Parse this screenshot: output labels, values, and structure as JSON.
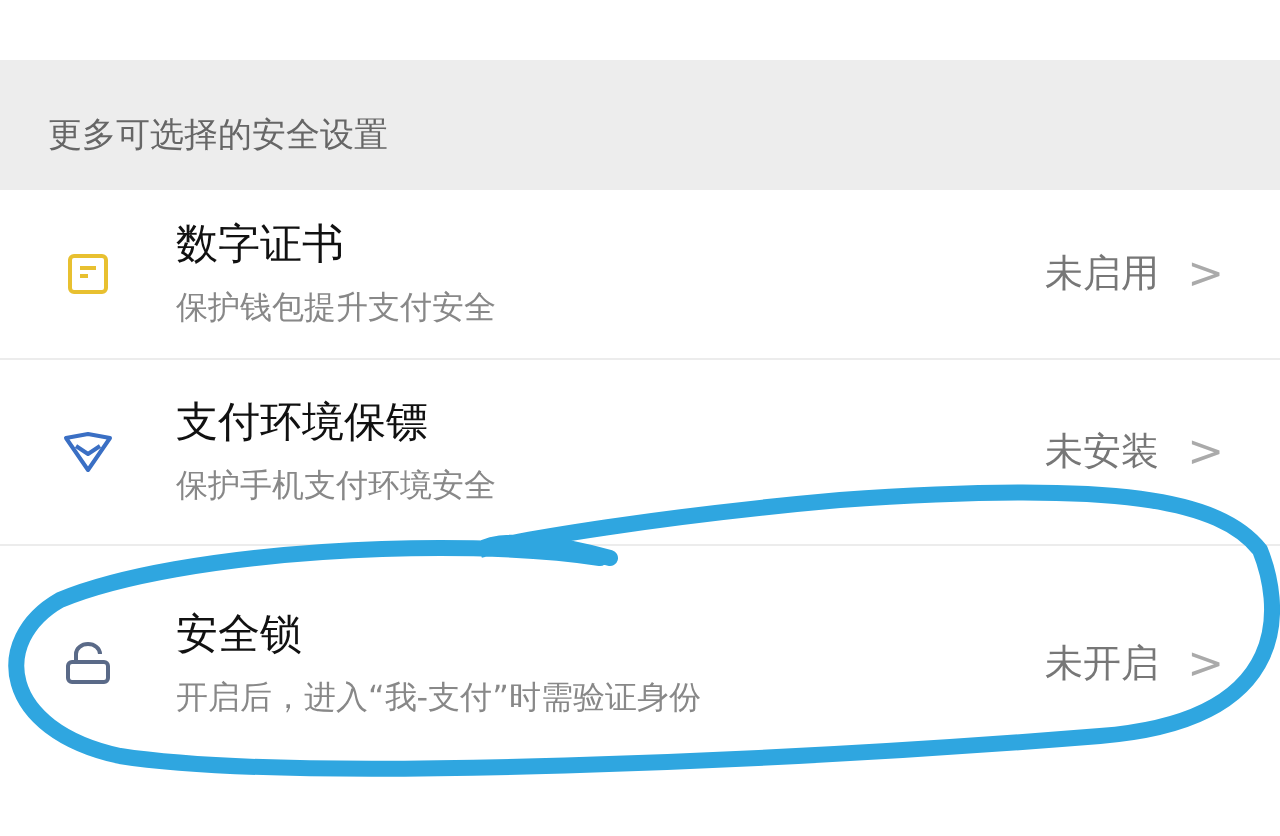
{
  "section_header": "更多可选择的安全设置",
  "items": [
    {
      "kind": "certificate",
      "title": "数字证书",
      "subtitle": "保护钱包提升支付安全",
      "status": "未启用",
      "chevron": ">"
    },
    {
      "kind": "shield",
      "title": "支付环境保镖",
      "subtitle": "保护手机支付环境安全",
      "status": "未安装",
      "chevron": ">"
    },
    {
      "kind": "lock",
      "title": "安全锁",
      "subtitle": "开启后，进入“我-支付”时需验证身份",
      "status": "未开启",
      "chevron": ">"
    }
  ]
}
